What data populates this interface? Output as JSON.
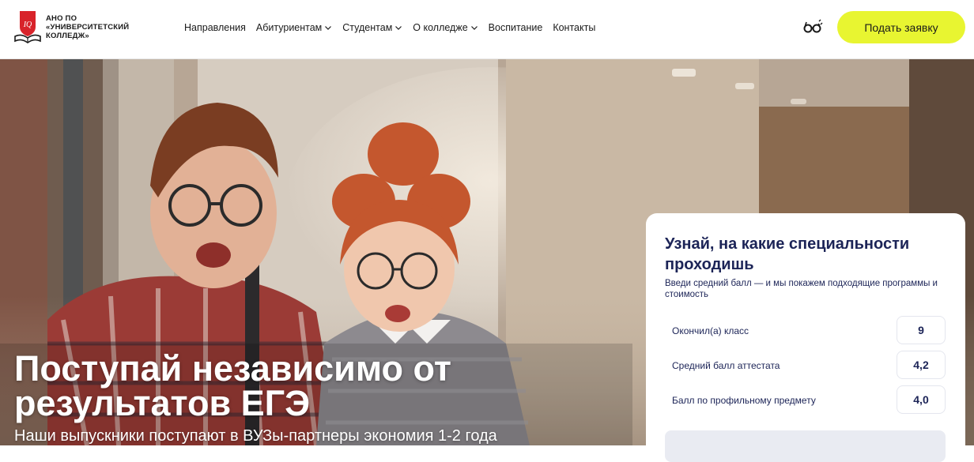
{
  "header": {
    "logo": {
      "badge_text": "IQ",
      "lines": [
        "АНО ПО",
        "«УНИВЕРСИТЕТСКИЙ",
        "КОЛЛЕДЖ»"
      ]
    },
    "nav": [
      {
        "label": "Направления",
        "has_dropdown": false
      },
      {
        "label": "Абитуриентам",
        "has_dropdown": true
      },
      {
        "label": "Студентам",
        "has_dropdown": true
      },
      {
        "label": "О колледже",
        "has_dropdown": true
      },
      {
        "label": "Воспитание",
        "has_dropdown": false
      },
      {
        "label": "Контакты",
        "has_dropdown": false
      }
    ],
    "accessibility_icon": "glasses-icon",
    "apply_button": "Подать заявку"
  },
  "hero": {
    "title_lines": [
      "Поступай независимо от",
      "результатов ЕГЭ"
    ],
    "subtitle": "Наши выпускники поступают в ВУЗы-партнеры экономия 1-2 года"
  },
  "calculator": {
    "title": "Узнай, на какие специальности проходишь",
    "description": "Введи средний балл — и мы покажем подходящие программы и стоимость",
    "fields": [
      {
        "label": "Окончил(а) класс",
        "value": "9"
      },
      {
        "label": "Средний балл аттестата",
        "value": "4,2"
      },
      {
        "label": "Балл по профильному предмету",
        "value": "4,0"
      }
    ]
  },
  "colors": {
    "accent": "#e8f531",
    "navy": "#1c2457",
    "logo_red": "#d8232a"
  }
}
